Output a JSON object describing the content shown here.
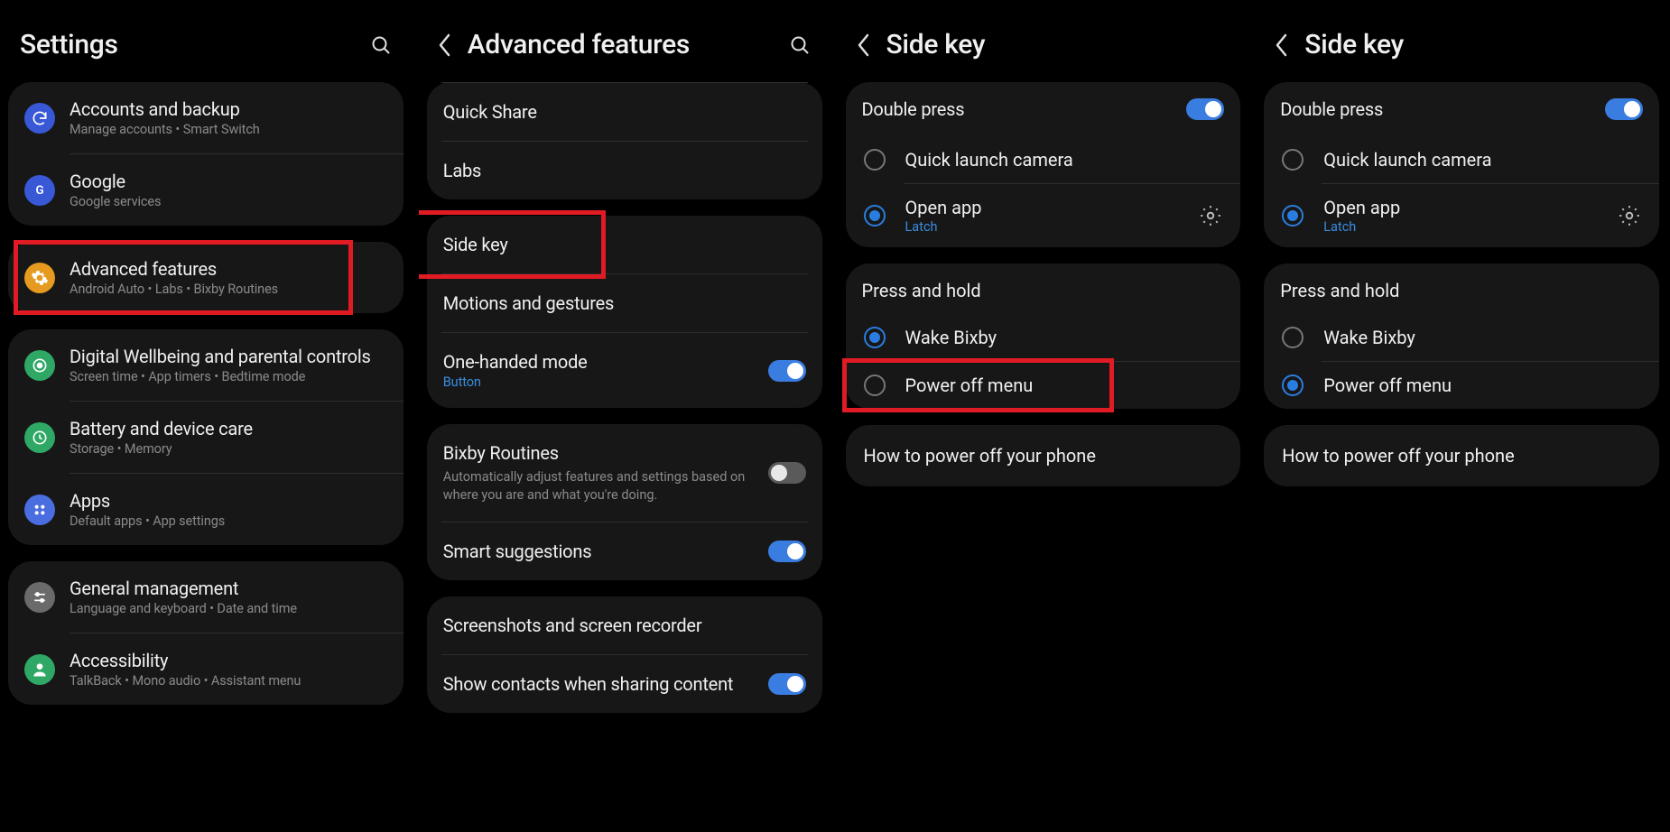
{
  "screen1": {
    "title": "Settings",
    "groups": [
      {
        "items": [
          {
            "icon": "sync",
            "iconBg": "#3858d6",
            "title": "Accounts and backup",
            "sub": "Manage accounts  •  Smart Switch"
          },
          {
            "icon": "g",
            "iconBg": "#3858d6",
            "title": "Google",
            "sub": "Google services"
          }
        ]
      },
      {
        "highlight": true,
        "items": [
          {
            "icon": "gear",
            "iconBg": "#e69a1f",
            "title": "Advanced features",
            "sub": "Android Auto  •  Labs  •  Bixby Routines"
          }
        ]
      },
      {
        "items": [
          {
            "icon": "target",
            "iconBg": "#2fa866",
            "title": "Digital Wellbeing and parental controls",
            "sub": "Screen time  •  App timers  •  Bedtime mode"
          },
          {
            "icon": "battery",
            "iconBg": "#2fa866",
            "title": "Battery and device care",
            "sub": "Storage  •  Memory"
          },
          {
            "icon": "grid",
            "iconBg": "#4a6de0",
            "title": "Apps",
            "sub": "Default apps  •  App settings"
          }
        ]
      },
      {
        "items": [
          {
            "icon": "sliders",
            "iconBg": "#6a6a6a",
            "title": "General management",
            "sub": "Language and keyboard  •  Date and time"
          },
          {
            "icon": "person",
            "iconBg": "#2fa866",
            "title": "Accessibility",
            "sub": "TalkBack  •  Mono audio  •  Assistant menu"
          }
        ]
      }
    ]
  },
  "screen2": {
    "title": "Advanced features",
    "groups": [
      [
        {
          "title": "Quick Share"
        },
        {
          "title": "Labs"
        }
      ],
      [
        {
          "title": "Side key",
          "highlight": true
        },
        {
          "title": "Motions and gestures"
        },
        {
          "title": "One-handed mode",
          "sub": "Button",
          "subBlue": true,
          "toggle": "on"
        }
      ],
      [
        {
          "title": "Bixby Routines",
          "desc": "Automatically adjust features and settings based on where you are and what you're doing.",
          "toggle": "off"
        },
        {
          "title": "Smart suggestions",
          "toggle": "on"
        }
      ],
      [
        {
          "title": "Screenshots and screen recorder"
        },
        {
          "title": "Show contacts when sharing content",
          "toggle": "on"
        }
      ]
    ]
  },
  "screen3": {
    "title": "Side key",
    "doublePress": {
      "label": "Double press",
      "toggle": "on",
      "options": [
        {
          "label": "Quick launch camera",
          "checked": false
        },
        {
          "label": "Open app",
          "sub": "Latch",
          "checked": true,
          "gear": true
        }
      ]
    },
    "pressHold": {
      "label": "Press and hold",
      "options": [
        {
          "label": "Wake Bixby",
          "checked": true
        },
        {
          "label": "Power off menu",
          "checked": false,
          "highlight": true
        }
      ]
    },
    "link": "How to power off your phone"
  },
  "screen4": {
    "title": "Side key",
    "doublePress": {
      "label": "Double press",
      "toggle": "on",
      "options": [
        {
          "label": "Quick launch camera",
          "checked": false
        },
        {
          "label": "Open app",
          "sub": "Latch",
          "checked": true,
          "gear": true
        }
      ]
    },
    "pressHold": {
      "label": "Press and hold",
      "options": [
        {
          "label": "Wake Bixby",
          "checked": false
        },
        {
          "label": "Power off menu",
          "checked": true
        }
      ]
    },
    "link": "How to power off your phone"
  }
}
